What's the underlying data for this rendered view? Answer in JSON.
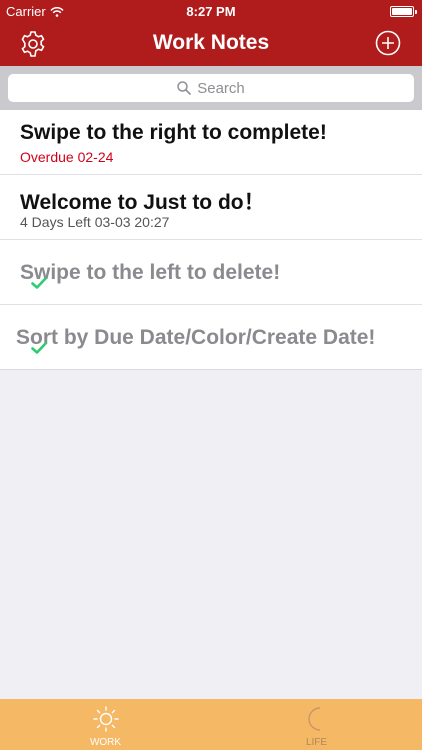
{
  "status_bar": {
    "carrier": "Carrier",
    "time": "8:27 PM"
  },
  "nav": {
    "title": "Work Notes",
    "left_icon": "gear-icon",
    "right_icon": "add-circle-icon"
  },
  "search": {
    "placeholder": "Search"
  },
  "notes": [
    {
      "title": "Swipe to the right to complete!",
      "subtitle": "Overdue 02-24",
      "status": "overdue"
    },
    {
      "title": "Welcome to Just to do！",
      "subtitle": "4 Days Left   03-03 20:27",
      "status": "active"
    },
    {
      "title": "Swipe to the left to delete!",
      "status": "completed"
    },
    {
      "title": "Sort by Due Date/Color/Create Date!",
      "status": "completed"
    }
  ],
  "tabs": [
    {
      "label": "WORK",
      "icon": "sun-icon",
      "active": true
    },
    {
      "label": "LIFE",
      "icon": "moon-icon",
      "active": false
    }
  ],
  "colors": {
    "nav_background": "#b01c1c",
    "overdue_text": "#d0021b",
    "check_green": "#2ecc71",
    "tab_bar": "#f5b865"
  }
}
